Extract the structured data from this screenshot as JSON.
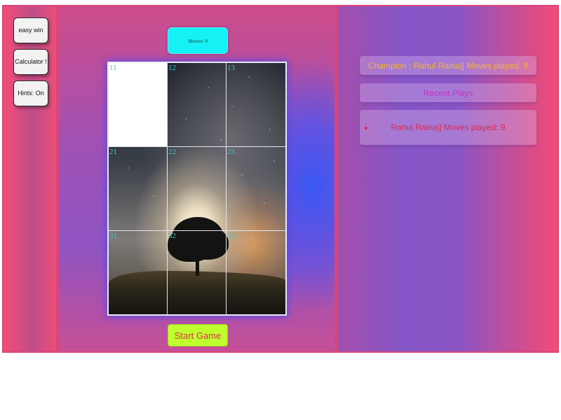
{
  "sidebar": {
    "buttons": [
      {
        "label": "easy win"
      },
      {
        "label": "Calculator !"
      },
      {
        "label": "Hints: On"
      }
    ]
  },
  "game": {
    "moves_label": "Moves: 0",
    "tiles": [
      {
        "label": "11",
        "empty": true
      },
      {
        "label": "12"
      },
      {
        "label": "13"
      },
      {
        "label": "21"
      },
      {
        "label": "22"
      },
      {
        "label": "23"
      },
      {
        "label": "31"
      },
      {
        "label": "32"
      },
      {
        "label": "33"
      }
    ],
    "start_label": "Start Game"
  },
  "scoreboard": {
    "champion": "Champion : Rahul Raina|| Moves played: 9",
    "recent_title": "Recent Plays",
    "recent": [
      "Rahul Raina|| Moves played: 9"
    ]
  },
  "colors": {
    "moves_bg": "#14f2f5",
    "start_bg": "#bfff2e",
    "start_text": "#e0314f",
    "champion_text": "#f2b52e",
    "recent_title_text": "#c033c0",
    "recent_item_text": "#d92b52",
    "tile_number": "#44c8c8"
  },
  "icons": {
    "board_image": "night-sky-tree-image",
    "list_bullet": "bullet-icon"
  }
}
